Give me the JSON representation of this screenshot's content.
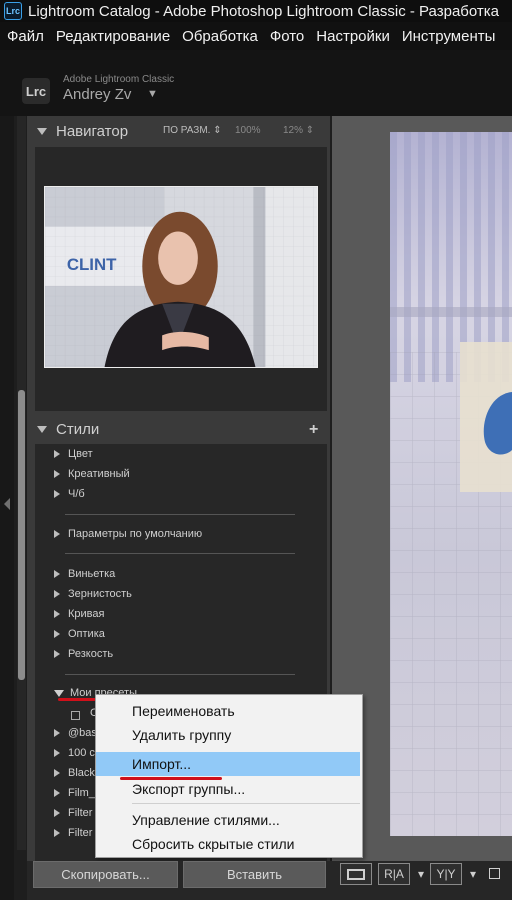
{
  "window": {
    "title": "Lightroom Catalog - Adobe Photoshop Lightroom Classic - Разработка",
    "app_icon": "Lrc"
  },
  "menu": [
    "Файл",
    "Редактирование",
    "Обработка",
    "Фото",
    "Настройки",
    "Инструменты"
  ],
  "identity": {
    "logo": "Lrc",
    "app_name": "Adobe Lightroom Classic",
    "user": "Andrey Zv",
    "caret": "▼"
  },
  "navigator": {
    "title": "Навигатор",
    "zoom_fit": "ПО РАЗМ.",
    "zoom_100": "100%",
    "zoom_12": "12%"
  },
  "styles": {
    "title": "Стили",
    "add": "+",
    "items": [
      "Цвет",
      "Креативный",
      "Ч/б",
      "Параметры по умолчанию",
      "Виньетка",
      "Зернистость",
      "Кривая",
      "Оптика",
      "Резкость",
      "Мои пресеты"
    ],
    "truncated": [
      "С",
      "@bas",
      "100 ci",
      "Black",
      "Film_",
      "Filter",
      "Filter"
    ]
  },
  "context_menu": {
    "items": [
      "Переименовать",
      "Удалить группу",
      "Импорт...",
      "Экспорт группы...",
      "Управление стилями...",
      "Сбросить скрытые стили"
    ],
    "highlighted": "Импорт..."
  },
  "bottom": {
    "copy": "Скопировать...",
    "paste": "Вставить",
    "ra": "R|A",
    "yy": "Y|Y",
    "dropdown": "▾"
  },
  "colors": {
    "panel_bg": "#3a3a3a",
    "list_bg": "#272727",
    "menu_bg": "#f2f2f2",
    "highlight": "#91c9f7",
    "annotation_red": "#d0101a"
  }
}
